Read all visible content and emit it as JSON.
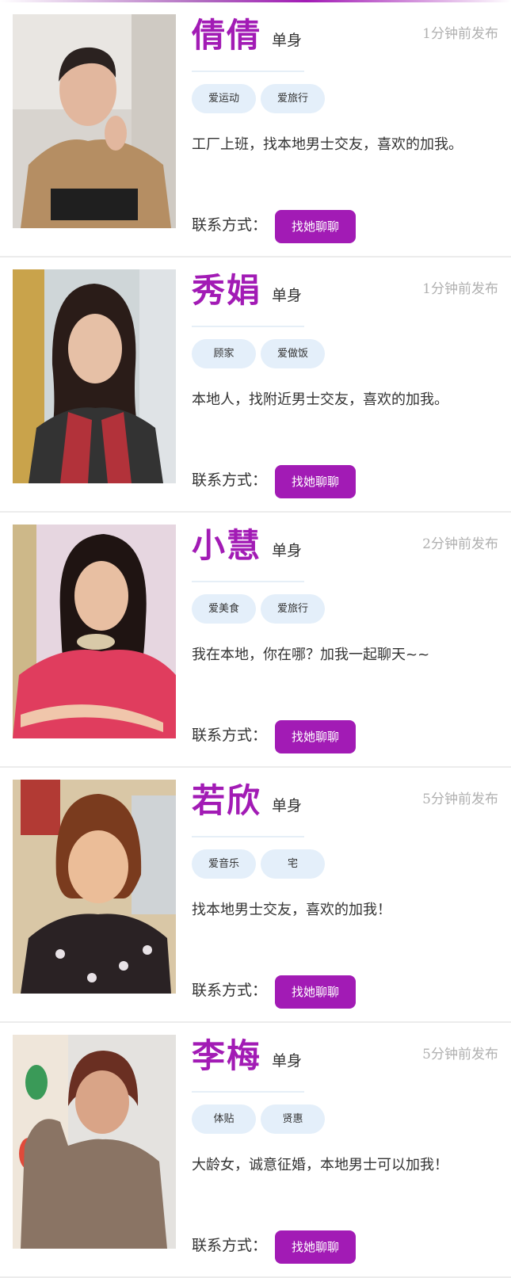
{
  "profiles": [
    {
      "name": "倩倩",
      "status": "单身",
      "time": "1分钟前发布",
      "tags": [
        "爱运动",
        "爱旅行"
      ],
      "description": "工厂上班，找本地男士交友，喜欢的加我。",
      "contact_label": "联系方式：",
      "button_label": "找她聊聊"
    },
    {
      "name": "秀娟",
      "status": "单身",
      "time": "1分钟前发布",
      "tags": [
        "顾家",
        "爱做饭"
      ],
      "description": "本地人，找附近男士交友，喜欢的加我。",
      "contact_label": "联系方式：",
      "button_label": "找她聊聊"
    },
    {
      "name": "小慧",
      "status": "单身",
      "time": "2分钟前发布",
      "tags": [
        "爱美食",
        "爱旅行"
      ],
      "description": "我在本地，你在哪？加我一起聊天~~",
      "contact_label": "联系方式：",
      "button_label": "找她聊聊"
    },
    {
      "name": "若欣",
      "status": "单身",
      "time": "5分钟前发布",
      "tags": [
        "爱音乐",
        "宅"
      ],
      "description": "找本地男士交友，喜欢的加我！",
      "contact_label": "联系方式：",
      "button_label": "找她聊聊"
    },
    {
      "name": "李梅",
      "status": "单身",
      "time": "5分钟前发布",
      "tags": [
        "体贴",
        "贤惠"
      ],
      "description": "大龄女，诚意征婚，本地男士可以加我！",
      "contact_label": "联系方式：",
      "button_label": "找她聊聊"
    }
  ],
  "colors": {
    "accent": "#a21bb5",
    "tag_bg": "#e4effa",
    "time_text": "#b0b0b0"
  }
}
